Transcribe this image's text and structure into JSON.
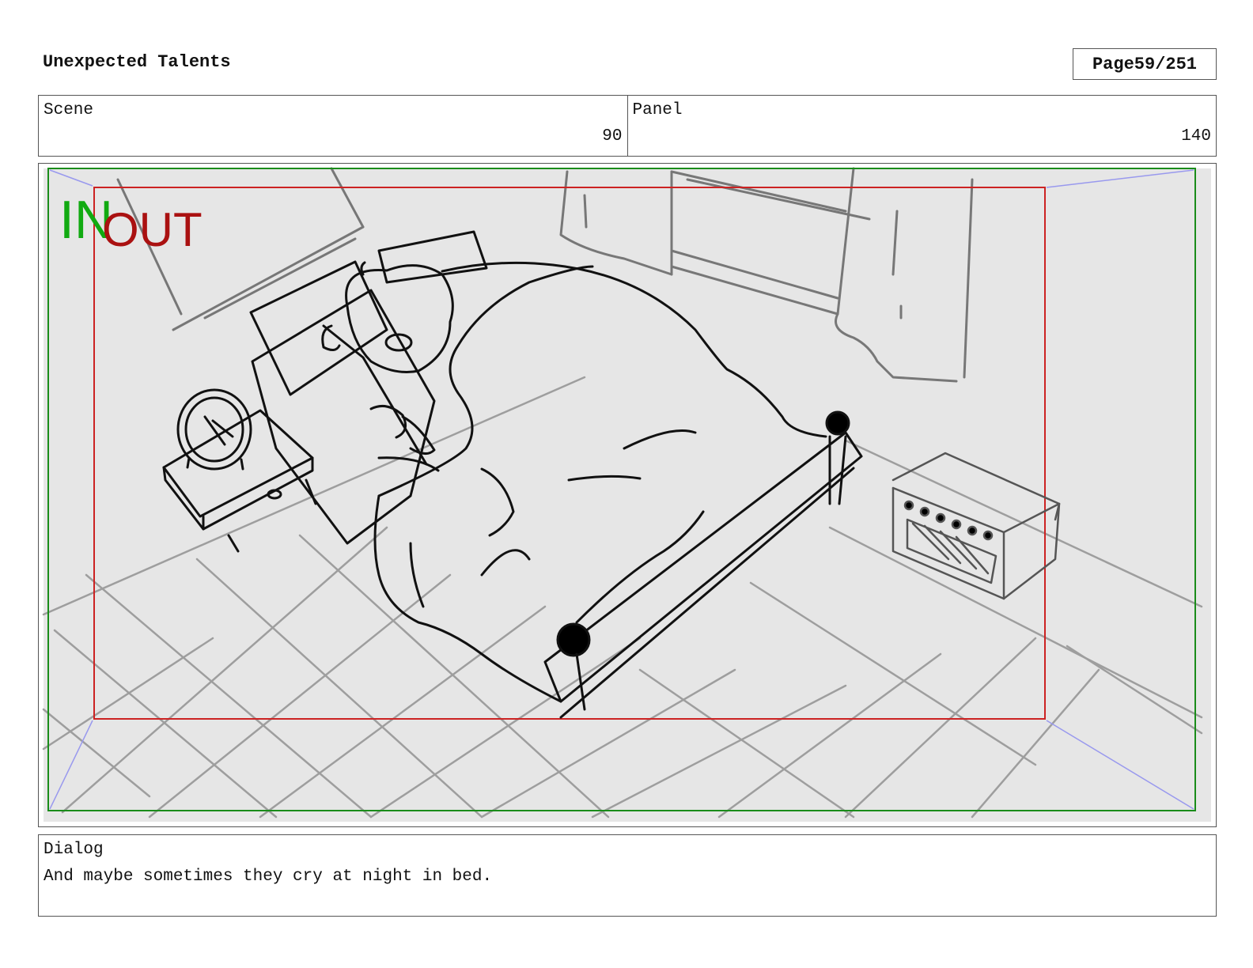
{
  "header": {
    "title": "Unexpected Talents",
    "page_label": "Page",
    "page_number": "59/251"
  },
  "info": {
    "scene_label": "Scene",
    "scene_value": "90",
    "panel_label": "Panel",
    "panel_value": "140"
  },
  "frame": {
    "in_label": "IN",
    "out_label": "OUT",
    "colors": {
      "in": "#11aa11",
      "out": "#aa1111",
      "guide": "#9999ee",
      "background": "#e6e6e6"
    }
  },
  "dialog": {
    "label": "Dialog",
    "text": "And maybe sometimes they cry at night in bed."
  }
}
